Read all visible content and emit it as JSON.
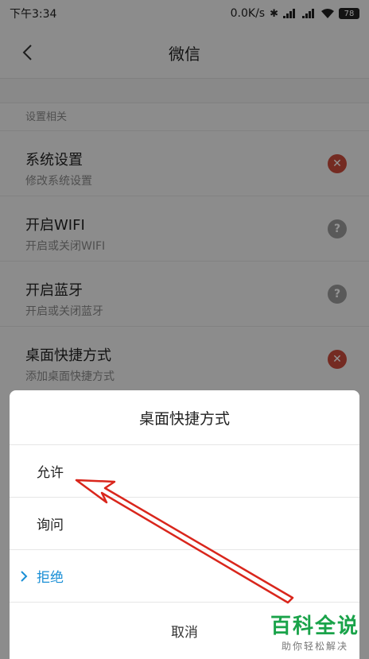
{
  "status_bar": {
    "time": "下午3:34",
    "network_speed": "0.0K/s",
    "battery": "78"
  },
  "title_bar": {
    "title": "微信"
  },
  "section": {
    "header": "设置相关"
  },
  "items": [
    {
      "title": "系统设置",
      "subtitle": "修改系统设置",
      "state": "deny"
    },
    {
      "title": "开启WIFI",
      "subtitle": "开启或关闭WIFI",
      "state": "ask"
    },
    {
      "title": "开启蓝牙",
      "subtitle": "开启或关闭蓝牙",
      "state": "ask"
    },
    {
      "title": "桌面快捷方式",
      "subtitle": "添加桌面快捷方式",
      "state": "deny"
    }
  ],
  "dialog": {
    "title": "桌面快捷方式",
    "options": [
      {
        "label": "允许",
        "selected": false
      },
      {
        "label": "询问",
        "selected": false
      },
      {
        "label": "拒绝",
        "selected": true
      }
    ],
    "cancel_label": "取消"
  },
  "watermark": {
    "main": "百科全说",
    "sub": "助你轻松解决"
  },
  "colors": {
    "accent_blue": "#1a8fd6",
    "deny_red": "#c94b3c",
    "ask_gray": "#9a9a9a",
    "arrow_red": "#d9261c",
    "watermark_green": "#1aa34a"
  },
  "icons": {
    "back": "chevron-left-icon",
    "deny_badge": "close-icon",
    "ask_badge": "question-icon",
    "selected_marker": "chevron-right-icon"
  }
}
